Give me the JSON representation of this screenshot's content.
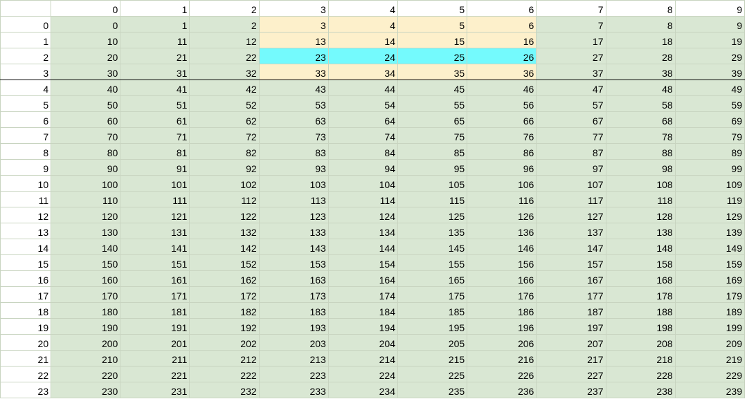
{
  "colors": {
    "cell_background": "#d9e7d3",
    "band_background": "#fdf0cb",
    "highlight_background": "#74fafd",
    "gridline": "#c8d4c0",
    "header_background": "#ffffff"
  },
  "sheet": {
    "corner_label": "",
    "column_headers": [
      "0",
      "1",
      "2",
      "3",
      "4",
      "5",
      "6",
      "7",
      "8",
      "9"
    ],
    "row_headers": [
      "0",
      "1",
      "2",
      "3",
      "4",
      "5",
      "6",
      "7",
      "8",
      "9",
      "10",
      "11",
      "12",
      "13",
      "14",
      "15",
      "16",
      "17",
      "18",
      "19",
      "20",
      "21",
      "22",
      "23"
    ],
    "rows": [
      [
        "0",
        "1",
        "2",
        "3",
        "4",
        "5",
        "6",
        "7",
        "8",
        "9"
      ],
      [
        "10",
        "11",
        "12",
        "13",
        "14",
        "15",
        "16",
        "17",
        "18",
        "19"
      ],
      [
        "20",
        "21",
        "22",
        "23",
        "24",
        "25",
        "26",
        "27",
        "28",
        "29"
      ],
      [
        "30",
        "31",
        "32",
        "33",
        "34",
        "35",
        "36",
        "37",
        "38",
        "39"
      ],
      [
        "40",
        "41",
        "42",
        "43",
        "44",
        "45",
        "46",
        "47",
        "48",
        "49"
      ],
      [
        "50",
        "51",
        "52",
        "53",
        "54",
        "55",
        "56",
        "57",
        "58",
        "59"
      ],
      [
        "60",
        "61",
        "62",
        "63",
        "64",
        "65",
        "66",
        "67",
        "68",
        "69"
      ],
      [
        "70",
        "71",
        "72",
        "73",
        "74",
        "75",
        "76",
        "77",
        "78",
        "79"
      ],
      [
        "80",
        "81",
        "82",
        "83",
        "84",
        "85",
        "86",
        "87",
        "88",
        "89"
      ],
      [
        "90",
        "91",
        "92",
        "93",
        "94",
        "95",
        "96",
        "97",
        "98",
        "99"
      ],
      [
        "100",
        "101",
        "102",
        "103",
        "104",
        "105",
        "106",
        "107",
        "108",
        "109"
      ],
      [
        "110",
        "111",
        "112",
        "113",
        "114",
        "115",
        "116",
        "117",
        "118",
        "119"
      ],
      [
        "120",
        "121",
        "122",
        "123",
        "124",
        "125",
        "126",
        "127",
        "128",
        "129"
      ],
      [
        "130",
        "131",
        "132",
        "133",
        "134",
        "135",
        "136",
        "137",
        "138",
        "139"
      ],
      [
        "140",
        "141",
        "142",
        "143",
        "144",
        "145",
        "146",
        "147",
        "148",
        "149"
      ],
      [
        "150",
        "151",
        "152",
        "153",
        "154",
        "155",
        "156",
        "157",
        "158",
        "159"
      ],
      [
        "160",
        "161",
        "162",
        "163",
        "164",
        "165",
        "166",
        "167",
        "168",
        "169"
      ],
      [
        "170",
        "171",
        "172",
        "173",
        "174",
        "175",
        "176",
        "177",
        "178",
        "179"
      ],
      [
        "180",
        "181",
        "182",
        "183",
        "184",
        "185",
        "186",
        "187",
        "188",
        "189"
      ],
      [
        "190",
        "191",
        "192",
        "193",
        "194",
        "195",
        "196",
        "197",
        "198",
        "199"
      ],
      [
        "200",
        "201",
        "202",
        "203",
        "204",
        "205",
        "206",
        "207",
        "208",
        "209"
      ],
      [
        "210",
        "211",
        "212",
        "213",
        "214",
        "215",
        "216",
        "217",
        "218",
        "219"
      ],
      [
        "220",
        "221",
        "222",
        "223",
        "224",
        "225",
        "226",
        "227",
        "228",
        "229"
      ],
      [
        "230",
        "231",
        "232",
        "233",
        "234",
        "235",
        "236",
        "237",
        "238",
        "239"
      ]
    ],
    "band_row_range": [
      0,
      3
    ],
    "band_col_range": [
      3,
      6
    ],
    "highlight_row": 2,
    "highlight_col_range": [
      3,
      6
    ],
    "frozen_rows": 4
  }
}
